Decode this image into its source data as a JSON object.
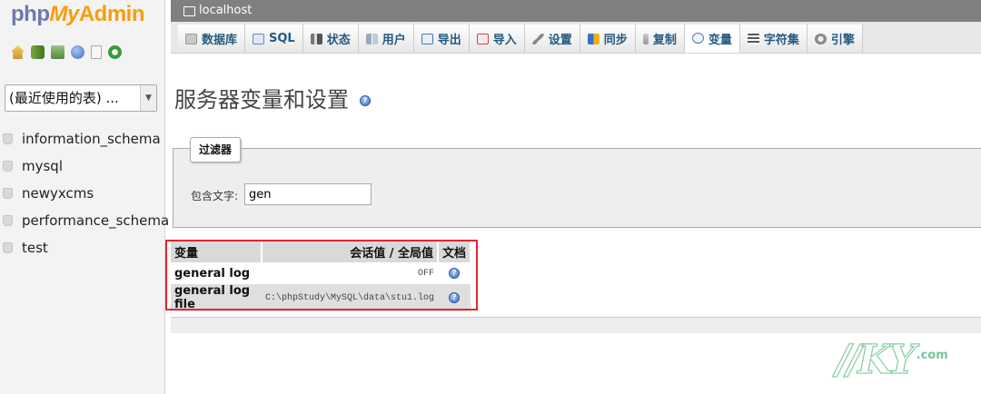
{
  "logo": {
    "php": "php",
    "my": "My",
    "admin": "Admin"
  },
  "nav_icons": [
    "home-icon",
    "database-icon",
    "exit-icon",
    "help-icon",
    "documents-icon",
    "reload-icon"
  ],
  "db_select": {
    "selected": "(最近使用的表) ..."
  },
  "databases": [
    "information_schema",
    "mysql",
    "newyxcms",
    "performance_schema",
    "test"
  ],
  "server": {
    "name": "localhost"
  },
  "tabs": [
    {
      "label": "数据库",
      "icon": "databases-icon"
    },
    {
      "label": "SQL",
      "icon": "sql-icon"
    },
    {
      "label": "状态",
      "icon": "status-icon"
    },
    {
      "label": "用户",
      "icon": "users-icon"
    },
    {
      "label": "导出",
      "icon": "export-icon"
    },
    {
      "label": "导入",
      "icon": "import-icon"
    },
    {
      "label": "设置",
      "icon": "settings-icon"
    },
    {
      "label": "同步",
      "icon": "synchronize-icon"
    },
    {
      "label": "复制",
      "icon": "replication-icon"
    },
    {
      "label": "变量",
      "icon": "variables-icon"
    },
    {
      "label": "字符集",
      "icon": "charset-icon"
    },
    {
      "label": "引擎",
      "icon": "engine-icon"
    }
  ],
  "active_tab": "变量",
  "page": {
    "title": "服务器变量和设置"
  },
  "filter": {
    "legend": "过滤器",
    "label": "包含文字:",
    "value": "gen"
  },
  "table": {
    "headers": {
      "variable": "变量",
      "value": "会话值 / 全局值",
      "doc": "文档"
    },
    "rows": [
      {
        "name": "general log",
        "value": "OFF"
      },
      {
        "name": "general log file",
        "value": "C:\\phpStudy\\MySQL\\data\\stu1.log"
      }
    ]
  },
  "watermark": {
    "suffix": ".com"
  },
  "colors": {
    "highlight": "#e8262c",
    "link": "#235a81",
    "logo_orange": "#f89c0e",
    "logo_blue": "#6c78af"
  }
}
